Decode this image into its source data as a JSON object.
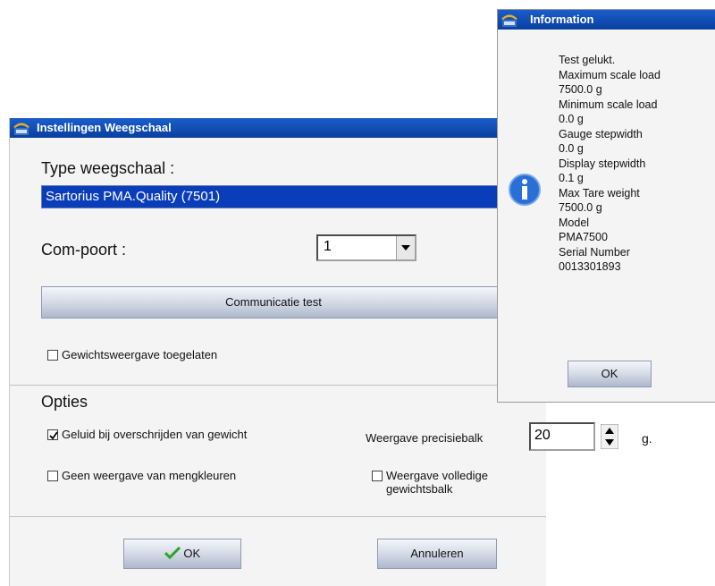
{
  "main_dialog": {
    "title": "Instellingen Weegschaal",
    "type_label": "Type weegschaal :",
    "type_value": "Sartorius PMA.Quality (7501)",
    "com_label": "Com-poort :",
    "com_value": "1",
    "test_button": "Communicatie test",
    "weight_display_checkbox": {
      "label": "Gewichtsweergave toegelaten",
      "checked": false
    },
    "options_heading": "Opties",
    "sound_checkbox": {
      "label": "Geluid bij overschrijden van gewicht",
      "checked": true
    },
    "precision_label": "Weergave precisiebalk",
    "precision_value": "20",
    "precision_unit": "g.",
    "mix_colors_checkbox": {
      "label": "Geen weergave van mengkleuren",
      "checked": false
    },
    "full_weight_bar_checkbox": {
      "label": "Weergave volledige gewichtsbalk",
      "checked": false
    },
    "ok_button": "OK",
    "cancel_button": "Annuleren"
  },
  "info_dialog": {
    "title": "Information",
    "lines": [
      "Test gelukt.",
      "Maximum scale load",
      "7500.0 g",
      "Minimum scale load",
      "0.0 g",
      "Gauge stepwidth",
      "0.0 g",
      "Display stepwidth",
      "0.1 g",
      "Max Tare weight",
      "7500.0 g",
      "Model",
      "PMA7500",
      "Serial Number",
      "0013301893"
    ],
    "ok_button": "OK",
    "icon": "info-icon"
  },
  "colors": {
    "titlebar": "#0a3f9e",
    "selection": "#0a3dba",
    "checkmark_green": "#2aa52a",
    "info_blue": "#2a6fd6"
  }
}
